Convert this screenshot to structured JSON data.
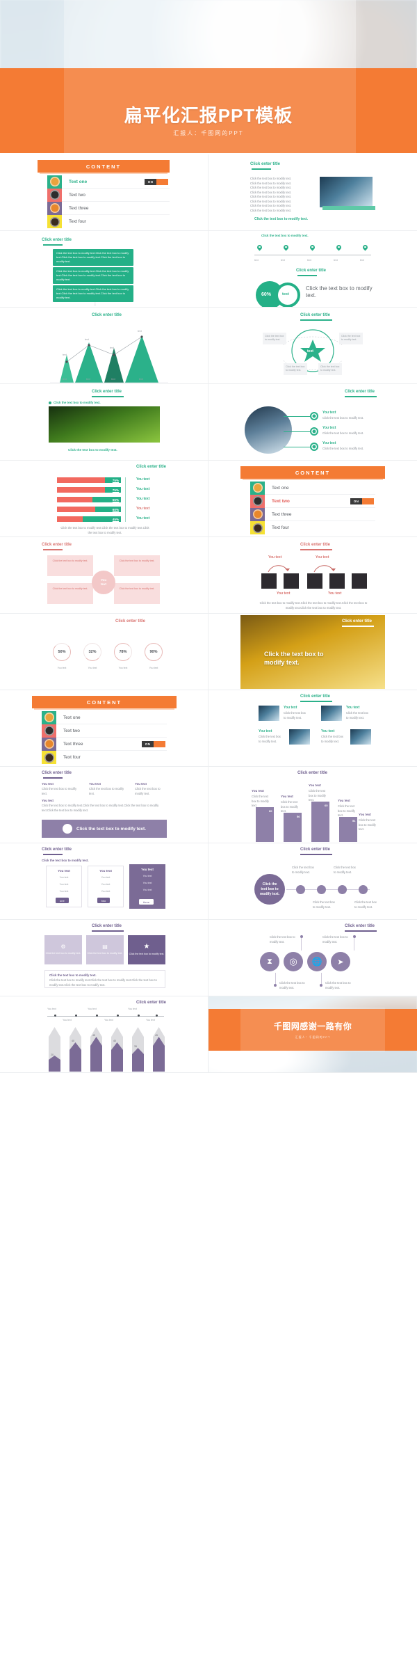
{
  "cover": {
    "title": "扁平化汇报PPT模板",
    "subtitle": "汇报人：千图网的PPT"
  },
  "labels": {
    "content_header": "CONTENT",
    "click_enter_title": "Click enter title",
    "click_modify": "Click the text box to modify text.",
    "body_line": "Click the text box to modify text.",
    "long_para": "Click the text box to modify text.Click the text box to modify text.Click the text box to modify text.Click the text box to modify text.",
    "you_text": "You text",
    "text": "text",
    "on": "ON",
    "click_the_text_box": "Click the text box",
    "to_modify_text": "to modify text.",
    "click_the": "Click the",
    "text_box_to": "text box to",
    "modify_text": "modify text.",
    "big_click": "Click the text box to modify text.",
    "dots": "⋮"
  },
  "content_list": {
    "items": [
      {
        "label": "Text one",
        "color": "#2bb18a",
        "icon": "coffee-icon",
        "glyph": "☕",
        "active": true,
        "toggle": "ON"
      },
      {
        "label": "Text two",
        "color": "#ef6f6b",
        "icon": "money-icon",
        "glyph": "💰",
        "active": false,
        "toggle": null
      },
      {
        "label": "Text three",
        "color": "#7b6b96",
        "icon": "email-icon",
        "glyph": "@",
        "active": false,
        "toggle": null
      },
      {
        "label": "Text four",
        "color": "#f5e135",
        "icon": "monitor-icon",
        "glyph": "🖥",
        "active": false,
        "toggle": null
      }
    ]
  },
  "content_list_2": {
    "items": [
      {
        "label": "Text one",
        "color": "#2bb18a",
        "icon": "coffee-icon",
        "glyph": "☕",
        "active": true,
        "toggle": null
      },
      {
        "label": "Text two",
        "color": "#ef6f6b",
        "icon": "money-icon",
        "glyph": "💰",
        "active": false,
        "toggle": "ON"
      },
      {
        "label": "Text three",
        "color": "#7b6b96",
        "icon": "email-icon",
        "glyph": "@",
        "active": false,
        "toggle": null
      },
      {
        "label": "Text four",
        "color": "#f5e135",
        "icon": "monitor-icon",
        "glyph": "🖥",
        "active": false,
        "toggle": null
      }
    ]
  },
  "content_list_3": {
    "items": [
      {
        "label": "Text one",
        "color": "#2bb18a",
        "icon": "coffee-icon",
        "glyph": "☕",
        "active": false,
        "toggle": null
      },
      {
        "label": "Text two",
        "color": "#ef6f6b",
        "icon": "money-icon",
        "glyph": "💰",
        "active": false,
        "toggle": null
      },
      {
        "label": "Text three",
        "color": "#7b6b96",
        "icon": "email-icon",
        "glyph": "@",
        "active": false,
        "toggle": "ON"
      },
      {
        "label": "Text four",
        "color": "#f5e135",
        "icon": "monitor-icon",
        "glyph": "🖥",
        "active": false,
        "toggle": null
      }
    ]
  },
  "timeline_pins": {
    "labels": [
      "text",
      "text",
      "text",
      "text",
      "text"
    ]
  },
  "donut_stat": {
    "value": "60%",
    "caption": "text",
    "headline": "Click the text box to modify text."
  },
  "chart_data": [
    {
      "type": "area",
      "title": "Click enter title",
      "categories": [
        "text",
        "text",
        "text",
        "text"
      ],
      "values": [
        30,
        72,
        55,
        92
      ],
      "labels": [
        "text",
        "text",
        "text",
        "text"
      ],
      "series": [
        {
          "name": "mountains",
          "values": [
            30,
            72,
            55,
            92
          ]
        }
      ],
      "colors": [
        "#3dbf96",
        "#2bb18a",
        "#1f7f63",
        "#2bb18a"
      ],
      "grid": false,
      "legend": "none"
    },
    {
      "type": "bar",
      "orientation": "horizontal",
      "title": "Click enter title",
      "categories": [
        "You text",
        "You text",
        "You text",
        "You text",
        "You text"
      ],
      "values": [
        75,
        75,
        55,
        60,
        45
      ],
      "value_labels": [
        "75%",
        "75%",
        "55%",
        "60%",
        "45%"
      ],
      "colors": {
        "track": "#f2695f",
        "fill": "#24b087"
      },
      "xlabel": "",
      "ylabel": "",
      "xlim": [
        0,
        100
      ],
      "footnote": "Click the text box to modify text.Click the text box to modify text.Click the text box to modify text."
    },
    {
      "type": "pie",
      "subtype": "donut-gauges",
      "title": "Click enter title",
      "categories": [
        "You text",
        "You text",
        "You text",
        "You text"
      ],
      "values": [
        50,
        32,
        78,
        90
      ],
      "value_labels": [
        "50%",
        "32%",
        "78%",
        "90%"
      ],
      "color": "#d9736f"
    },
    {
      "type": "bar",
      "orientation": "vertical",
      "title": "Click enter title",
      "categories": [
        "You text",
        "You text",
        "You text",
        "You text"
      ],
      "values": [
        60,
        56,
        65,
        51
      ],
      "value_labels": [
        "60",
        "56",
        "65",
        "51"
      ],
      "color": "#8e80a8",
      "ylim": [
        0,
        80
      ],
      "grid": false
    },
    {
      "type": "bar",
      "orientation": "vertical",
      "subtype": "arrow",
      "title": "Click enter title",
      "categories": [
        "You text",
        "You text",
        "You text",
        "You text",
        "You text",
        "You text"
      ],
      "values": [
        20,
        40,
        45,
        40,
        35,
        45
      ],
      "value_labels": [
        "20",
        "40",
        "45",
        "40",
        "35",
        "45"
      ],
      "colors": {
        "track": "#dcdcdf",
        "fill": "#7b6b96"
      },
      "ylim": [
        0,
        60
      ],
      "grid": false
    }
  ],
  "pricing": {
    "cards": [
      {
        "title": "You text",
        "rows": [
          "You text",
          "You text",
          "You text"
        ],
        "button": "one",
        "highlight": false
      },
      {
        "title": "You text",
        "rows": [
          "You text",
          "You text",
          "You text"
        ],
        "button": "two",
        "highlight": false
      },
      {
        "title": "You text",
        "rows": [
          "You text",
          "You text",
          "You text"
        ],
        "button": "three",
        "highlight": true
      }
    ]
  },
  "icon_row": {
    "icons": [
      {
        "name": "hourglass-icon",
        "glyph": "⧗"
      },
      {
        "name": "target-icon",
        "glyph": "◎"
      },
      {
        "name": "globe-icon",
        "glyph": "🌐"
      },
      {
        "name": "paper-plane-icon",
        "glyph": "➤"
      }
    ],
    "callouts": [
      "Click the text box to modify text.",
      "Click the text box to modify text.",
      "Click the text box to modify text.",
      "Click the text box to modify text."
    ]
  },
  "feature_cards": {
    "items": [
      {
        "icon": "gear-icon",
        "glyph": "⚙",
        "title": "You text",
        "body": "Click the text box to modify text."
      },
      {
        "icon": "chart-icon",
        "glyph": "▤",
        "title": "You text",
        "body": "Click the text box to modify text."
      },
      {
        "icon": "star-icon",
        "glyph": "★",
        "title": "You text",
        "body": "Click the text box to modify text."
      }
    ],
    "banner": "Click the text box to modify text."
  },
  "closing": {
    "title": "千图网感谢一路有你",
    "subtitle": "汇报人：千图网的PPT"
  }
}
